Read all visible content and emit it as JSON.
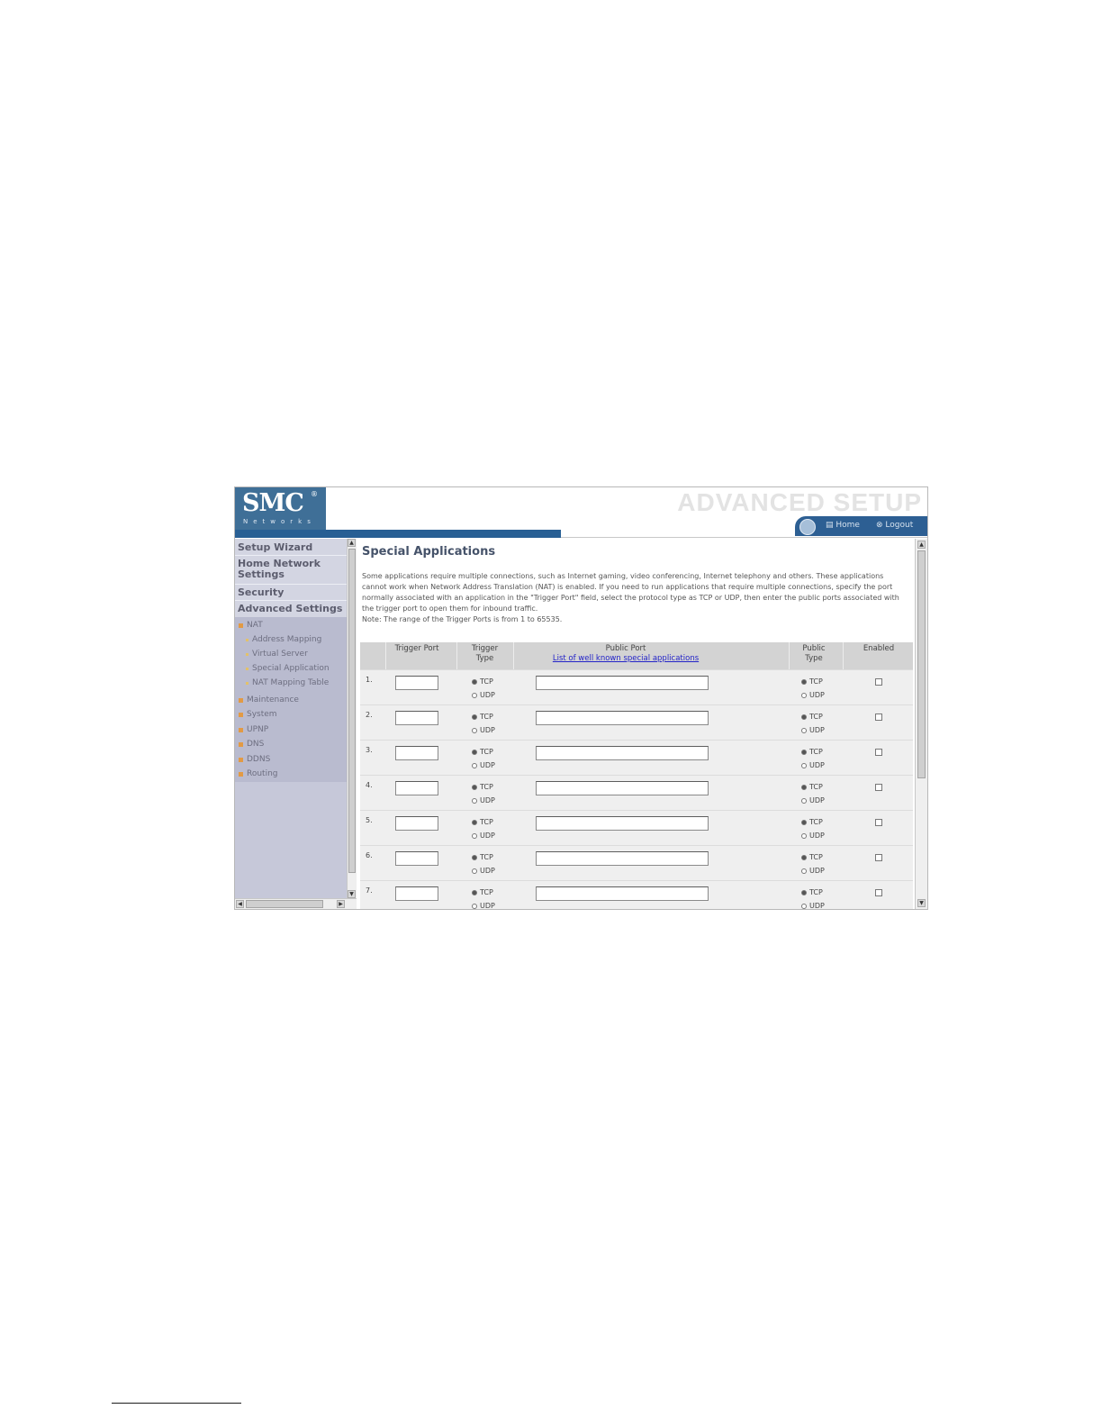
{
  "brand": {
    "logo": "SMC",
    "registered": "®",
    "subtitle": "Networks"
  },
  "header": {
    "title": "ADVANCED SETUP",
    "home": "Home",
    "logout": "Logout"
  },
  "sidebar": {
    "main": [
      "Setup Wizard",
      "Home Network Settings",
      "Security",
      "Advanced Settings"
    ],
    "nat": "NAT",
    "nat_items": [
      "Address Mapping",
      "Virtual Server",
      "Special Application",
      "NAT Mapping Table"
    ],
    "other": [
      "Maintenance",
      "System",
      "UPNP",
      "DNS",
      "DDNS",
      "Routing"
    ]
  },
  "content": {
    "title": "Special Applications",
    "description": "Some applications require multiple connections, such as Internet gaming, video conferencing, Internet telephony and others. These applications cannot work when Network Address Translation (NAT) is enabled. If you need to run applications that require multiple connections, specify the port normally associated with an application in the \"Trigger Port\" field, select the protocol type as TCP or UDP, then enter the public ports associated with the trigger port to open them for inbound traffic.",
    "note": "Note: The range of the Trigger Ports is from 1 to 65535."
  },
  "table": {
    "headers": {
      "trigger_port": "Trigger Port",
      "trigger_type": "Trigger Type",
      "public_port": "Public Port",
      "link": "List of well known special applications",
      "public_type": "Public Type",
      "enabled": "Enabled"
    },
    "rows": [
      {
        "num": "1.",
        "trigger_type": "TCP",
        "public_type": "TCP",
        "enabled": false
      },
      {
        "num": "2.",
        "trigger_type": "TCP",
        "public_type": "TCP",
        "enabled": false
      },
      {
        "num": "3.",
        "trigger_type": "TCP",
        "public_type": "TCP",
        "enabled": false
      },
      {
        "num": "4.",
        "trigger_type": "TCP",
        "public_type": "TCP",
        "enabled": false
      },
      {
        "num": "5.",
        "trigger_type": "TCP",
        "public_type": "TCP",
        "enabled": false
      },
      {
        "num": "6.",
        "trigger_type": "TCP",
        "public_type": "TCP",
        "enabled": false
      },
      {
        "num": "7.",
        "trigger_type": "TCP",
        "public_type": "TCP",
        "enabled": false
      }
    ],
    "options": {
      "tcp": "TCP",
      "udp": "UDP"
    }
  }
}
